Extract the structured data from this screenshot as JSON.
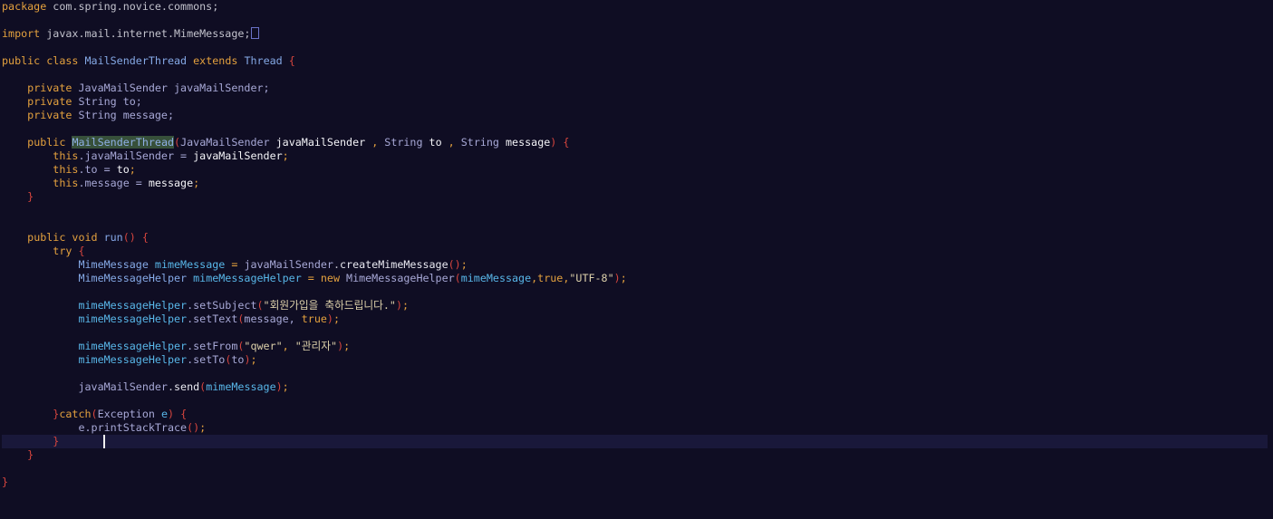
{
  "editor": {
    "language": "java",
    "caret": {
      "line": 33,
      "column": 14
    },
    "colors": {
      "background": "#0f0d23",
      "current_line": "#19183a",
      "keyword": "#e4a13e",
      "bracket": "#d6453e",
      "variable": "#58b6e8",
      "string": "#dcd0aa",
      "highlight": "#37503a"
    },
    "lines": [
      {
        "n": 1,
        "tokens": [
          {
            "t": "package",
            "c": "kw"
          },
          {
            "t": " com.spring.novice.commons;",
            "c": "pl"
          }
        ]
      },
      {
        "n": 3,
        "tokens": [
          {
            "t": "import",
            "c": "kw"
          },
          {
            "t": " javax.mail.internet.MimeMessage;",
            "c": "pl"
          }
        ],
        "fold": true
      },
      {
        "n": 5,
        "tokens": [
          {
            "t": "public class",
            "c": "kw"
          },
          {
            "t": " ",
            "c": "pl"
          },
          {
            "t": "MailSenderThread",
            "c": "cls"
          },
          {
            "t": " ",
            "c": "pl"
          },
          {
            "t": "extends",
            "c": "kw"
          },
          {
            "t": " ",
            "c": "pl"
          },
          {
            "t": "Thread",
            "c": "cls"
          },
          {
            "t": " ",
            "c": "pl"
          },
          {
            "t": "{",
            "c": "par"
          }
        ]
      },
      {
        "n": 7,
        "tokens": [
          {
            "t": "    ",
            "c": "pl"
          },
          {
            "t": "private",
            "c": "kw"
          },
          {
            "t": " JavaMailSender javaMailSender;",
            "c": "ty"
          }
        ]
      },
      {
        "n": 8,
        "tokens": [
          {
            "t": "    ",
            "c": "pl"
          },
          {
            "t": "private",
            "c": "kw"
          },
          {
            "t": " String to;",
            "c": "ty"
          }
        ]
      },
      {
        "n": 9,
        "tokens": [
          {
            "t": "    ",
            "c": "pl"
          },
          {
            "t": "private",
            "c": "kw"
          },
          {
            "t": " String message;",
            "c": "ty"
          }
        ]
      },
      {
        "n": 11,
        "tokens": [
          {
            "t": "    ",
            "c": "pl"
          },
          {
            "t": "public",
            "c": "kw"
          },
          {
            "t": " ",
            "c": "pl"
          },
          {
            "t": "MailSenderThread",
            "c": "hl"
          },
          {
            "t": "(",
            "c": "par"
          },
          {
            "t": "JavaMailSender ",
            "c": "ty"
          },
          {
            "t": "javaMailSender",
            "c": "wh"
          },
          {
            "t": " , ",
            "c": "kw"
          },
          {
            "t": "String ",
            "c": "ty"
          },
          {
            "t": "to",
            "c": "wh"
          },
          {
            "t": " , ",
            "c": "kw"
          },
          {
            "t": "String ",
            "c": "ty"
          },
          {
            "t": "message",
            "c": "wh"
          },
          {
            "t": ")",
            "c": "par"
          },
          {
            "t": " ",
            "c": "pl"
          },
          {
            "t": "{",
            "c": "par"
          }
        ]
      },
      {
        "n": 12,
        "tokens": [
          {
            "t": "        ",
            "c": "pl"
          },
          {
            "t": "this",
            "c": "kw"
          },
          {
            "t": ".javaMailSender = ",
            "c": "ty"
          },
          {
            "t": "javaMailSender",
            "c": "wh"
          },
          {
            "t": ";",
            "c": "kw"
          }
        ]
      },
      {
        "n": 13,
        "tokens": [
          {
            "t": "        ",
            "c": "pl"
          },
          {
            "t": "this",
            "c": "kw"
          },
          {
            "t": ".to = ",
            "c": "ty"
          },
          {
            "t": "to",
            "c": "wh"
          },
          {
            "t": ";",
            "c": "kw"
          }
        ]
      },
      {
        "n": 14,
        "tokens": [
          {
            "t": "        ",
            "c": "pl"
          },
          {
            "t": "this",
            "c": "kw"
          },
          {
            "t": ".message = ",
            "c": "ty"
          },
          {
            "t": "message",
            "c": "wh"
          },
          {
            "t": ";",
            "c": "kw"
          }
        ]
      },
      {
        "n": 15,
        "tokens": [
          {
            "t": "    ",
            "c": "pl"
          },
          {
            "t": "}",
            "c": "par"
          }
        ]
      },
      {
        "n": 18,
        "tokens": [
          {
            "t": "    ",
            "c": "pl"
          },
          {
            "t": "public void",
            "c": "kw"
          },
          {
            "t": " ",
            "c": "pl"
          },
          {
            "t": "run",
            "c": "fn"
          },
          {
            "t": "()",
            "c": "par"
          },
          {
            "t": " ",
            "c": "pl"
          },
          {
            "t": "{",
            "c": "par"
          }
        ]
      },
      {
        "n": 19,
        "tokens": [
          {
            "t": "        ",
            "c": "pl"
          },
          {
            "t": "try",
            "c": "kw"
          },
          {
            "t": " ",
            "c": "pl"
          },
          {
            "t": "{",
            "c": "par"
          }
        ]
      },
      {
        "n": 20,
        "tokens": [
          {
            "t": "            ",
            "c": "pl"
          },
          {
            "t": "MimeMessage ",
            "c": "cls"
          },
          {
            "t": "mimeMessage",
            "c": "var"
          },
          {
            "t": " = ",
            "c": "kw"
          },
          {
            "t": "javaMailSender",
            "c": "ty"
          },
          {
            "t": ".",
            "c": "pl"
          },
          {
            "t": "createMimeMessage",
            "c": "mth"
          },
          {
            "t": "()",
            "c": "par"
          },
          {
            "t": ";",
            "c": "kw"
          }
        ]
      },
      {
        "n": 21,
        "tokens": [
          {
            "t": "            ",
            "c": "pl"
          },
          {
            "t": "MimeMessageHelper ",
            "c": "cls"
          },
          {
            "t": "mimeMessageHelper",
            "c": "var"
          },
          {
            "t": " = ",
            "c": "kw"
          },
          {
            "t": "new",
            "c": "kw"
          },
          {
            "t": " MimeMessageHelper",
            "c": "ty"
          },
          {
            "t": "(",
            "c": "par"
          },
          {
            "t": "mimeMessage",
            "c": "var"
          },
          {
            "t": ",",
            "c": "kw"
          },
          {
            "t": "true",
            "c": "kw"
          },
          {
            "t": ",",
            "c": "kw"
          },
          {
            "t": "\"UTF-8\"",
            "c": "str"
          },
          {
            "t": ")",
            "c": "par"
          },
          {
            "t": ";",
            "c": "kw"
          }
        ]
      },
      {
        "n": 23,
        "tokens": [
          {
            "t": "            ",
            "c": "pl"
          },
          {
            "t": "mimeMessageHelper",
            "c": "var"
          },
          {
            "t": ".setSubject",
            "c": "ty"
          },
          {
            "t": "(",
            "c": "par"
          },
          {
            "t": "\"회원가입을 축하드립니다.\"",
            "c": "str"
          },
          {
            "t": ")",
            "c": "par"
          },
          {
            "t": ";",
            "c": "kw"
          }
        ]
      },
      {
        "n": 24,
        "tokens": [
          {
            "t": "            ",
            "c": "pl"
          },
          {
            "t": "mimeMessageHelper",
            "c": "var"
          },
          {
            "t": ".setText",
            "c": "ty"
          },
          {
            "t": "(",
            "c": "par"
          },
          {
            "t": "message, ",
            "c": "ty"
          },
          {
            "t": "true",
            "c": "kw"
          },
          {
            "t": ")",
            "c": "par"
          },
          {
            "t": ";",
            "c": "kw"
          }
        ]
      },
      {
        "n": 26,
        "tokens": [
          {
            "t": "            ",
            "c": "pl"
          },
          {
            "t": "mimeMessageHelper",
            "c": "var"
          },
          {
            "t": ".setFrom",
            "c": "ty"
          },
          {
            "t": "(",
            "c": "par"
          },
          {
            "t": "\"qwer\"",
            "c": "str"
          },
          {
            "t": ", ",
            "c": "kw"
          },
          {
            "t": "\"관리자\"",
            "c": "str"
          },
          {
            "t": ")",
            "c": "par"
          },
          {
            "t": ";",
            "c": "kw"
          }
        ]
      },
      {
        "n": 27,
        "tokens": [
          {
            "t": "            ",
            "c": "pl"
          },
          {
            "t": "mimeMessageHelper",
            "c": "var"
          },
          {
            "t": ".setTo",
            "c": "ty"
          },
          {
            "t": "(",
            "c": "par"
          },
          {
            "t": "to",
            "c": "ty"
          },
          {
            "t": ")",
            "c": "par"
          },
          {
            "t": ";",
            "c": "kw"
          }
        ]
      },
      {
        "n": 29,
        "tokens": [
          {
            "t": "            ",
            "c": "pl"
          },
          {
            "t": "javaMailSender",
            "c": "ty"
          },
          {
            "t": ".",
            "c": "pl"
          },
          {
            "t": "send",
            "c": "mth"
          },
          {
            "t": "(",
            "c": "par"
          },
          {
            "t": "mimeMessage",
            "c": "var"
          },
          {
            "t": ")",
            "c": "par"
          },
          {
            "t": ";",
            "c": "kw"
          }
        ]
      },
      {
        "n": 31,
        "tokens": [
          {
            "t": "        ",
            "c": "pl"
          },
          {
            "t": "}",
            "c": "par"
          },
          {
            "t": "catch",
            "c": "kw"
          },
          {
            "t": "(",
            "c": "par"
          },
          {
            "t": "Exception ",
            "c": "ty"
          },
          {
            "t": "e",
            "c": "var"
          },
          {
            "t": ")",
            "c": "par"
          },
          {
            "t": " ",
            "c": "pl"
          },
          {
            "t": "{",
            "c": "par"
          }
        ]
      },
      {
        "n": 32,
        "tokens": [
          {
            "t": "            ",
            "c": "pl"
          },
          {
            "t": "e.printStackTrace",
            "c": "ty"
          },
          {
            "t": "()",
            "c": "par"
          },
          {
            "t": ";",
            "c": "kw"
          }
        ]
      },
      {
        "n": 33,
        "tokens": [
          {
            "t": "        ",
            "c": "pl"
          },
          {
            "t": "}",
            "c": "par"
          }
        ]
      },
      {
        "n": 34,
        "tokens": [
          {
            "t": "    ",
            "c": "pl"
          },
          {
            "t": "}",
            "c": "par"
          }
        ]
      },
      {
        "n": 36,
        "tokens": [
          {
            "t": "}",
            "c": "par"
          }
        ]
      }
    ]
  }
}
